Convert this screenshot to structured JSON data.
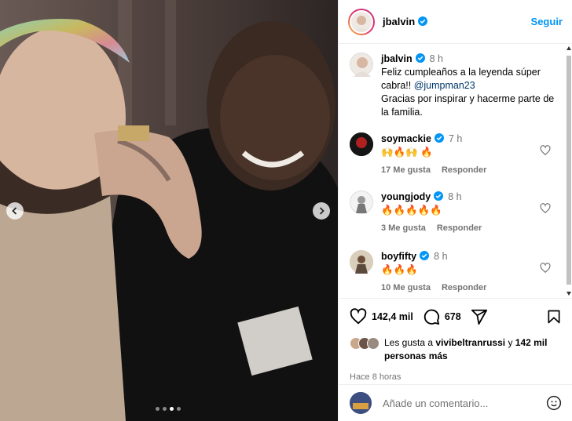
{
  "post": {
    "author": "jbalvin",
    "follow_label": "Seguir",
    "caption": {
      "author": "jbalvin",
      "time": "8 h",
      "text_line1": "Feliz cumpleaños a la leyenda súper",
      "text_line2_prefix": "cabra!! ",
      "mention": "@jumpman23",
      "text_line3": "Gracias por inspirar y hacerme parte de",
      "text_line4": "la familia."
    },
    "carousel": {
      "total": 4,
      "active_index": 2
    }
  },
  "comments": [
    {
      "user": "soymackie",
      "time": "7 h",
      "text": "🙌🔥🙌 🔥",
      "likes": "17 Me gusta",
      "reply": "Responder"
    },
    {
      "user": "youngjody",
      "time": "8 h",
      "text": "🔥🔥🔥🔥🔥",
      "likes": "3 Me gusta",
      "reply": "Responder"
    },
    {
      "user": "boyfifty",
      "time": "8 h",
      "text": "🔥🔥🔥",
      "likes": "10 Me gusta",
      "reply": "Responder"
    }
  ],
  "actions": {
    "like_count": "142,4 mil",
    "comment_count": "678"
  },
  "liked_by": {
    "prefix": "Les gusta a ",
    "user": "vivibeltranrussi",
    "middle": " y ",
    "count": "142 mil",
    "suffix_bold": "personas más"
  },
  "posted_ago": "Hace 8 horas",
  "add_comment": {
    "placeholder": "Añade un comentario..."
  },
  "colors": {
    "accent": "#0095f6",
    "verified": "#0095f6",
    "muted": "#737373"
  },
  "icons": [
    "chevron-left-icon",
    "chevron-right-icon",
    "verified-icon",
    "heart-icon",
    "comment-icon",
    "share-icon",
    "bookmark-icon",
    "emoji-icon"
  ]
}
